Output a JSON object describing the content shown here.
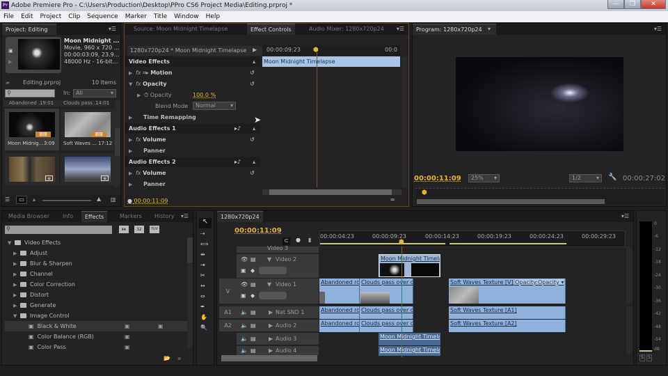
{
  "window": {
    "title": "Adobe Premiere Pro - C:\\Users\\Production\\Desktop\\PPro CS6 Project Media\\Editing.prproj *",
    "app_icon": "Pr",
    "controls": {
      "minimize": "—",
      "maximize": "❐",
      "close": "✕"
    }
  },
  "menu": [
    "File",
    "Edit",
    "Project",
    "Clip",
    "Sequence",
    "Marker",
    "Title",
    "Window",
    "Help"
  ],
  "project": {
    "tab": "Project: Editing",
    "preview": {
      "name": "Moon Midnight ...",
      "line1": "Movie, 960 x 720 ...",
      "line2": "00:00:03:09, 23.9...",
      "line3": "48000 Hz - 16-bit..."
    },
    "file": "Editing.prproj",
    "count": "10 Items",
    "search_placeholder": "",
    "in_label": "In:",
    "in_value": "All",
    "items": [
      {
        "name": "Abandoned ...",
        "dur": "19:01"
      },
      {
        "name": "Clouds pass ...",
        "dur": "14:01"
      },
      {
        "name": "Moon Midnig...",
        "dur": "3:09"
      },
      {
        "name": "Soft Waves ...",
        "dur": "17:12"
      },
      {
        "name": "",
        "dur": ""
      },
      {
        "name": "",
        "dur": ""
      }
    ]
  },
  "source_tabs": {
    "source": "Source: Moon Midnight Timelapse",
    "effect_controls": "Effect Controls",
    "audio_mixer": "Audio Mixer: 1280x720p24"
  },
  "effect_controls": {
    "sequence_clip": "1280x720p24 * Moon Midnight Timelapse",
    "timecode_start": "00:00:09:23",
    "timecode_end": "00:0",
    "clip_bar": "Moon Midnight Timelapse",
    "video_effects": "Video Effects",
    "motion": "Motion",
    "opacity": "Opacity",
    "opacity_prop": "Opacity",
    "opacity_value": "100.0 %",
    "blend_mode_label": "Blend Mode",
    "blend_mode_value": "Normal",
    "time_remapping": "Time Remapping",
    "audio_effects_1": "Audio Effects 1",
    "volume_1": "Volume",
    "panner_1": "Panner",
    "audio_effects_2": "Audio Effects 2",
    "volume_2": "Volume",
    "panner_2": "Panner",
    "current_time": "00:00:11:09"
  },
  "program": {
    "tab": "Program: 1280x720p24",
    "timecode": "00:00:11:09",
    "zoom": "25%",
    "resolution": "1/2",
    "duration": "00:00:27:02"
  },
  "effects_panel": {
    "tabs": [
      "Media Browser",
      "Info",
      "Effects",
      "Markers",
      "History"
    ],
    "active_tab": "Effects",
    "search_placeholder": "",
    "badges": [
      "⏵⏵",
      "32",
      "YUV"
    ],
    "tree": [
      {
        "label": "Video Effects",
        "level": 0,
        "expanded": true,
        "type": "folder"
      },
      {
        "label": "Adjust",
        "level": 1,
        "expanded": false,
        "type": "folder"
      },
      {
        "label": "Blur & Sharpen",
        "level": 1,
        "expanded": false,
        "type": "folder"
      },
      {
        "label": "Channel",
        "level": 1,
        "expanded": false,
        "type": "folder"
      },
      {
        "label": "Color Correction",
        "level": 1,
        "expanded": false,
        "type": "folder"
      },
      {
        "label": "Distort",
        "level": 1,
        "expanded": false,
        "type": "folder"
      },
      {
        "label": "Generate",
        "level": 1,
        "expanded": false,
        "type": "folder"
      },
      {
        "label": "Image Control",
        "level": 1,
        "expanded": true,
        "type": "folder"
      },
      {
        "label": "Black & White",
        "level": 2,
        "type": "effect",
        "selected": true
      },
      {
        "label": "Color Balance (RGB)",
        "level": 2,
        "type": "effect"
      },
      {
        "label": "Color Pass",
        "level": 2,
        "type": "effect"
      }
    ]
  },
  "timeline": {
    "tab": "1280x720p24",
    "timecode": "00:00:11:09",
    "ruler": [
      "00:00:04:23",
      "00:00:09:23",
      "00:00:14:23",
      "00:00:19:23",
      "00:00:24:23",
      "00:00:29:23"
    ],
    "tracks": [
      {
        "id": "",
        "name": "Video 3"
      },
      {
        "id": "",
        "name": "Video 2"
      },
      {
        "id": "V",
        "name": "Video 1"
      },
      {
        "id": "A1",
        "name": "Nat SND 1"
      },
      {
        "id": "A2",
        "name": "Audio 2"
      },
      {
        "id": "",
        "name": "Audio 3"
      },
      {
        "id": "",
        "name": "Audio 4"
      }
    ],
    "clips": {
      "v2_moon": "Moon Midnight Timela",
      "v1_abandoned": "Abandoned rc",
      "v1_clouds": "Clouds pass over c",
      "v1_soft": "Soft Waves Texture [V]",
      "v1_soft_opacity": "Opacity:Opacity ▾",
      "a1_abandoned": "Abandoned rc",
      "a1_clouds": "Clouds pass over c",
      "a1_soft": "Soft Waves Texture [A1]",
      "a2_abandoned": "Abandoned rc",
      "a2_clouds": "Clouds pass over c",
      "a2_soft": "Soft Waves Texture [A2]",
      "a3_moon": "Moon Midnight Timela",
      "a4_moon": "Moon Midnight Timela"
    }
  },
  "audio_meter": {
    "scale": [
      "0",
      "-6",
      "-12",
      "-18",
      "-24",
      "-30",
      "-36",
      "-42",
      "-48",
      "-54",
      "dB"
    ],
    "solo": [
      "S",
      "S"
    ]
  }
}
